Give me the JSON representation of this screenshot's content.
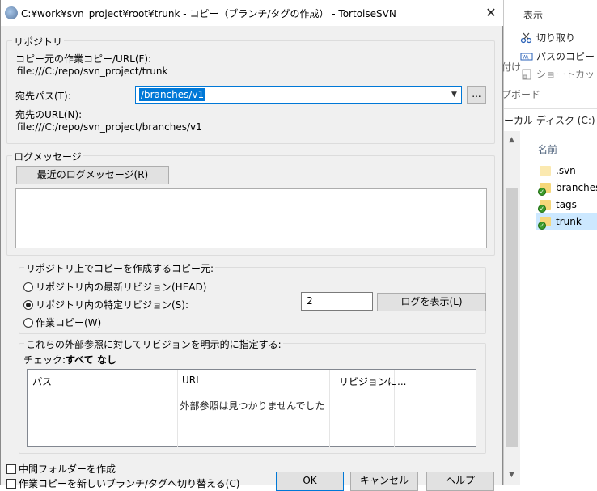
{
  "window": {
    "title": "C:¥work¥svn_project¥root¥trunk - コピー（ブランチ/タグの作成） - TortoiseSVN",
    "close_glyph": "✕"
  },
  "repository": {
    "group_label": "リポジトリ",
    "from_label": "コピー元の作業コピー/URL(F):",
    "from_value": "file:///C:/repo/svn_project/trunk",
    "to_path_label": "宛先パス(T):",
    "to_path_value": "/branches/v1",
    "browse_label": "...",
    "to_url_label": "宛先のURL(N):",
    "to_url_value": "file:///C:/repo/svn_project/branches/v1"
  },
  "log": {
    "group_label": "ログメッセージ",
    "recent_button": "最近のログメッセージ(R)",
    "message": ""
  },
  "source": {
    "group_label": "リポジトリ上でコピーを作成するコピー元:",
    "options": [
      {
        "label": "リポジトリ内の最新リビジョン(HEAD)",
        "selected": false
      },
      {
        "label": "リポジトリ内の特定リビジョン(S):",
        "selected": true
      },
      {
        "label": "作業コピー(W)",
        "selected": false
      }
    ],
    "revision_value": "2",
    "show_log_button": "ログを表示(L)"
  },
  "externals": {
    "group_label": "これらの外部参照に対してリビジョンを明示的に指定する:",
    "check_label": "チェック:",
    "check_all": "すべて",
    "check_none": "なし",
    "columns": [
      "パス",
      "URL",
      "リビジョンに..."
    ],
    "empty_text": "外部参照は見つかりませんでした"
  },
  "options": {
    "create_folders": "中間フォルダーを作成",
    "switch_wc": "作業コピーを新しいブランチ/タグへ切り替える(C)"
  },
  "buttons": {
    "ok": "OK",
    "cancel": "キャンセル",
    "help": "ヘルプ"
  },
  "explorer": {
    "tab_view": "表示",
    "cut": "切り取り",
    "copy_path": "パスのコピー",
    "paste_shortcut": "ショートカットの貼",
    "fragment_1": "付け",
    "fragment_2": "プボード",
    "address": "ーカル ディスク (C:)  >  w",
    "column_name": "名前",
    "files": [
      {
        "name": ".svn",
        "versioned": false,
        "selected": false
      },
      {
        "name": "branches",
        "versioned": true,
        "selected": false
      },
      {
        "name": "tags",
        "versioned": true,
        "selected": false
      },
      {
        "name": "trunk",
        "versioned": true,
        "selected": true
      }
    ]
  }
}
